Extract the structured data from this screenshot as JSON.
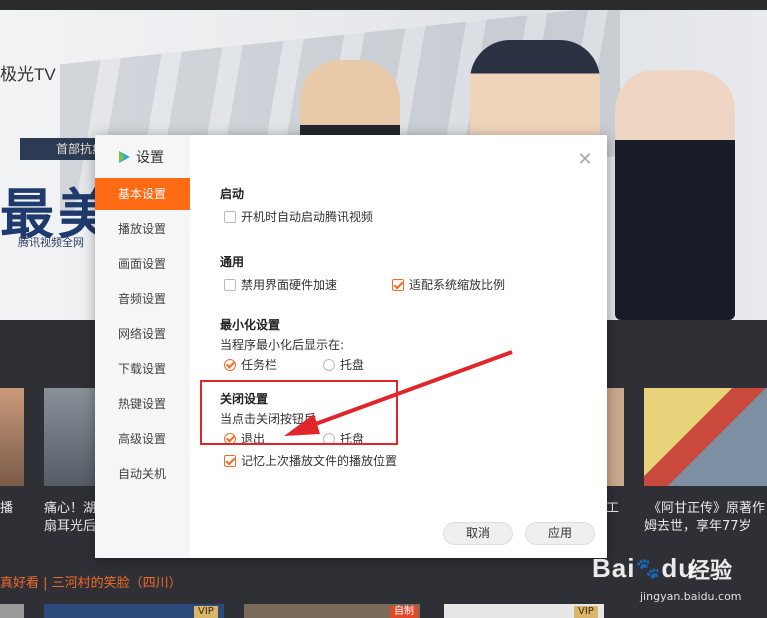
{
  "background": {
    "logo": "极光TV",
    "banner_tag": "首部抗疫",
    "banner_big": "最美",
    "banner_caption": "腾讯视频全网",
    "thumb_captions": [
      {
        "text": "播"
      },
      {
        "text": "痛心！湖"
      },
      {
        "text": "扇耳光后"
      },
      {
        "text": "工"
      },
      {
        "text": "《阿甘正传》原著作"
      },
      {
        "text": "姆去世，享年77岁"
      }
    ],
    "orange_row": "真好看 | 三河村的笑脸（四川）",
    "badges": [
      "VIP",
      "自制",
      "VIP"
    ]
  },
  "dialog": {
    "title": "设置",
    "close_icon": "close-icon",
    "nav": [
      {
        "label": "基本设置",
        "active": true
      },
      {
        "label": "播放设置",
        "active": false
      },
      {
        "label": "画面设置",
        "active": false
      },
      {
        "label": "音频设置",
        "active": false
      },
      {
        "label": "网络设置",
        "active": false
      },
      {
        "label": "下载设置",
        "active": false
      },
      {
        "label": "热键设置",
        "active": false
      },
      {
        "label": "高级设置",
        "active": false
      },
      {
        "label": "自动关机",
        "active": false
      }
    ],
    "sections": {
      "startup": {
        "title": "启动",
        "autostart": {
          "label": "开机时自动启动腾讯视频",
          "checked": false
        }
      },
      "general": {
        "title": "通用",
        "disable_hw": {
          "label": "禁用界面硬件加速",
          "checked": false
        },
        "adapt_scale": {
          "label": "适配系统缩放比例",
          "checked": true
        }
      },
      "minimize": {
        "title": "最小化设置",
        "prompt": "当程序最小化后显示在:",
        "taskbar": {
          "label": "任务栏",
          "selected": true
        },
        "tray": {
          "label": "托盘",
          "selected": false
        }
      },
      "close": {
        "title": "关闭设置",
        "prompt": "当点击关闭按钮后",
        "exit": {
          "label": "退出",
          "selected": true
        },
        "tray": {
          "label": "托盘",
          "selected": false
        },
        "remember": {
          "label": "记忆上次播放文件的播放位置",
          "checked": true
        }
      }
    },
    "buttons": {
      "cancel": "取消",
      "apply": "应用"
    }
  },
  "annotation": {
    "color": "#e0262a"
  },
  "watermark": {
    "brand": "Bai",
    "paw": "paw-icon",
    "brand_end": "du",
    "cn": "经验",
    "url": "jingyan.baidu.com"
  },
  "colors": {
    "accent": "#ff6a14"
  }
}
